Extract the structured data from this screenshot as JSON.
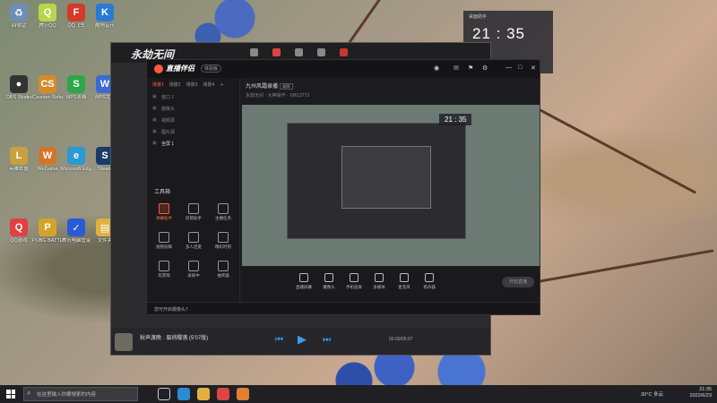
{
  "desktop": {
    "icons": [
      {
        "label": "回收站",
        "color": "#6d8fb5",
        "glyph": "♻"
      },
      {
        "label": "腾讯QQ",
        "color": "#b8d64a",
        "glyph": "Q"
      },
      {
        "label": "QQ飞车",
        "color": "#d43a2a",
        "glyph": "F"
      },
      {
        "label": "酷狗音乐",
        "color": "#2a7ad4",
        "glyph": "K"
      },
      {
        "label": "OBS Studio",
        "color": "#333",
        "glyph": "●"
      },
      {
        "label": "Counter-Strike Global",
        "color": "#d48b2a",
        "glyph": "CS"
      },
      {
        "label": "WPS表格",
        "color": "#2aa84a",
        "glyph": "S"
      },
      {
        "label": "WPS文字",
        "color": "#3a6ad4",
        "glyph": "W"
      },
      {
        "label": "英雄联盟",
        "color": "#c8a040",
        "glyph": "L"
      },
      {
        "label": "WeGame",
        "color": "#d4742a",
        "glyph": "W"
      },
      {
        "label": "Microsoft Edge",
        "color": "#2a9ad4",
        "glyph": "e"
      },
      {
        "label": "Steam",
        "color": "#1a3a6a",
        "glyph": "S"
      },
      {
        "label": "QQ游戏",
        "color": "#e04040",
        "glyph": "Q"
      },
      {
        "label": "PUBG BATTLEGR",
        "color": "#d4a42a",
        "glyph": "P"
      },
      {
        "label": "腾讯电脑管家",
        "color": "#2a5ad4",
        "glyph": "✓"
      },
      {
        "label": "文件夹",
        "color": "#e0b040",
        "glyph": "▤"
      }
    ]
  },
  "clock_widget": {
    "header": "桌面助手",
    "time": "21 : 35"
  },
  "outer_app": {
    "logo": "永劫无间",
    "music_title": "秋声渡晚 · 眉俏樱落 (5′07版)",
    "music_time": "00:00/05:07"
  },
  "main_window": {
    "brand": "直播伴侣",
    "badge": "体验版",
    "scene_tabs": [
      "场景1",
      "场景2",
      "场景3",
      "场景4"
    ],
    "scenes": [
      "窗口 1",
      "摄像头",
      "视频源",
      "图片源",
      "全屏 1"
    ],
    "room_title": "九州风霜录播",
    "room_tag": "录屏",
    "room_sub": "永劫无间 · 大神操作",
    "room_meta": "10613773",
    "tools_header": "工具箱",
    "tools": [
      "弹幕助手",
      "房管助手",
      "主播任务",
      "视频投稿",
      "多人连麦",
      "精彩时刻",
      "玩游戏",
      "录屏中",
      "抽奖器"
    ],
    "controls": [
      "直播屏幕",
      "摄像头",
      "手机投屏",
      "多媒体",
      "麦克风",
      "扬声器"
    ],
    "go_live": "开始直播",
    "status": "您可开启摄像头？",
    "inner_clock": "21 : 35"
  },
  "taskbar": {
    "search_placeholder": "在这里输入你要搜索的内容",
    "weather": "30°C 多云",
    "time": "21:35",
    "date": "2022/6/23"
  }
}
